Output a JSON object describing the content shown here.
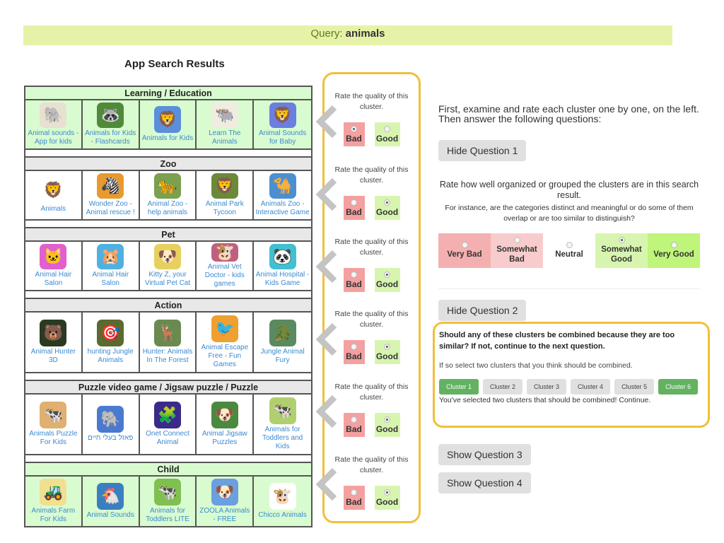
{
  "query": {
    "label": "Query:",
    "value": "animals"
  },
  "results_title": "App Search Results",
  "clusters": [
    {
      "name": "Learning / Education",
      "theme": "green",
      "rating": "bad",
      "apps": [
        {
          "name": "Animal sounds - App for kids",
          "icon": "🐘",
          "bg": "#e8e0d0"
        },
        {
          "name": "Animals for Kids - Flashcards",
          "icon": "🦝",
          "bg": "#4f8a3a"
        },
        {
          "name": "Animals for Kids",
          "icon": "🦁",
          "bg": "#5b8fdc"
        },
        {
          "name": "Learn The Animals",
          "icon": "🐃",
          "bg": "#f0ece0"
        },
        {
          "name": "Animal Sounds for Baby",
          "icon": "🦁",
          "bg": "#6a7fe0"
        }
      ]
    },
    {
      "name": "Zoo",
      "theme": "gray",
      "rating": "good",
      "apps": [
        {
          "name": "Animals",
          "icon": "🦁",
          "bg": "#ffffff"
        },
        {
          "name": "Wonder Zoo - Animal rescue !",
          "icon": "🦓",
          "bg": "#e89a30"
        },
        {
          "name": "Animal Zoo - help animals",
          "icon": "🐆",
          "bg": "#7aa050"
        },
        {
          "name": "Animal Park Tycoon",
          "icon": "🦁",
          "bg": "#6a8a3a"
        },
        {
          "name": "Animals Zoo - Interactive Game",
          "icon": "🐪",
          "bg": "#4a90d0"
        }
      ]
    },
    {
      "name": "Pet",
      "theme": "gray",
      "rating": "good",
      "apps": [
        {
          "name": "Animal Hair Salon",
          "icon": "🐱",
          "bg": "#e060d0"
        },
        {
          "name": "Animal Hair Salon",
          "icon": "🐹",
          "bg": "#50b0e0"
        },
        {
          "name": "Kitty Z, your Virtual Pet Cat",
          "icon": "🐶",
          "bg": "#e8d060"
        },
        {
          "name": "Animal Vet Doctor - kids games",
          "icon": "🐮",
          "bg": "#c06080"
        },
        {
          "name": "Animal Hospital - Kids Game",
          "icon": "🐼",
          "bg": "#40c0d0"
        }
      ]
    },
    {
      "name": "Action",
      "theme": "gray",
      "rating": "good",
      "apps": [
        {
          "name": "Animal Hunter 3D",
          "icon": "🐻",
          "bg": "#2a3a20"
        },
        {
          "name": "hunting Jungle Animals",
          "icon": "🎯",
          "bg": "#5a6a30"
        },
        {
          "name": "Hunter: Animals In The Forest",
          "icon": "🦌",
          "bg": "#6a8a50"
        },
        {
          "name": "Animal Escape Free - Fun Games",
          "icon": "🐦",
          "bg": "#f0a030"
        },
        {
          "name": "Jungle Animal Fury",
          "icon": "🐊",
          "bg": "#5a8a60"
        }
      ]
    },
    {
      "name": "Puzzle video game / Jigsaw puzzle / Puzzle",
      "theme": "gray",
      "rating": "good",
      "apps": [
        {
          "name": "Animals Puzzle For Kids",
          "icon": "🐄",
          "bg": "#e0b070"
        },
        {
          "name": "פאזל בעלי חיים",
          "icon": "🐘",
          "bg": "#4a7ad0"
        },
        {
          "name": "Onet Connect Animal",
          "icon": "🧩",
          "bg": "#3a2a8a"
        },
        {
          "name": "Animal Jigsaw Puzzles",
          "icon": "🐶",
          "bg": "#4a8a40"
        },
        {
          "name": "Animals for Toddlers and Kids",
          "icon": "🐄",
          "bg": "#b0d070"
        }
      ]
    },
    {
      "name": "Child",
      "theme": "green",
      "rating": "good",
      "apps": [
        {
          "name": "Animals Farm For Kids",
          "icon": "🚜",
          "bg": "#f0e090"
        },
        {
          "name": "Animal Sounds",
          "icon": "🐔",
          "bg": "#3a80c0"
        },
        {
          "name": "Animals for Toddlers LITE",
          "icon": "🐄",
          "bg": "#80c050"
        },
        {
          "name": "ZOOLA Animals - FREE",
          "icon": "🐶",
          "bg": "#6aa0e0"
        },
        {
          "name": "Chicco Animals",
          "icon": "🐮",
          "bg": "#ffffff"
        }
      ]
    }
  ],
  "rating": {
    "prompt": "Rate the quality of this cluster.",
    "bad_label": "Bad",
    "good_label": "Good"
  },
  "right": {
    "intro": "First, examine and rate each cluster one by one, on the left. Then answer the following questions:",
    "q1": {
      "toggle": "Hide Question 1",
      "text": "Rate how well organized or grouped the clusters are in this search result.",
      "sub": "For instance, are the categories distinct and meaningful or do some of them overlap or are too similar to distinguish?",
      "options": [
        {
          "label": "Very Bad",
          "color": "#f4b0b0",
          "checked": false
        },
        {
          "label": "Somewhat Bad",
          "color": "#f8cccc",
          "checked": false
        },
        {
          "label": "Neutral",
          "color": "#ffffff",
          "checked": false
        },
        {
          "label": "Somewhat Good",
          "color": "#d8f5b0",
          "checked": true
        },
        {
          "label": "Very Good",
          "color": "#bff57a",
          "checked": false
        }
      ]
    },
    "q2": {
      "toggle": "Hide Question 2",
      "title": "Should any of these clusters be combined because they are too similar? If not, continue to the next question.",
      "sub": "If so select two clusters that you think should be combined.",
      "clusters": [
        {
          "label": "Cluster 1",
          "selected": true
        },
        {
          "label": "Cluster 2",
          "selected": false
        },
        {
          "label": "Cluster 3",
          "selected": false
        },
        {
          "label": "Cluster 4",
          "selected": false
        },
        {
          "label": "Cluster 5",
          "selected": false
        },
        {
          "label": "Cluster 6",
          "selected": true
        }
      ],
      "message": "You've selected two clusters that should be combined! Continue."
    },
    "q3_toggle": "Show Question 3",
    "q4_toggle": "Show Question 4"
  }
}
